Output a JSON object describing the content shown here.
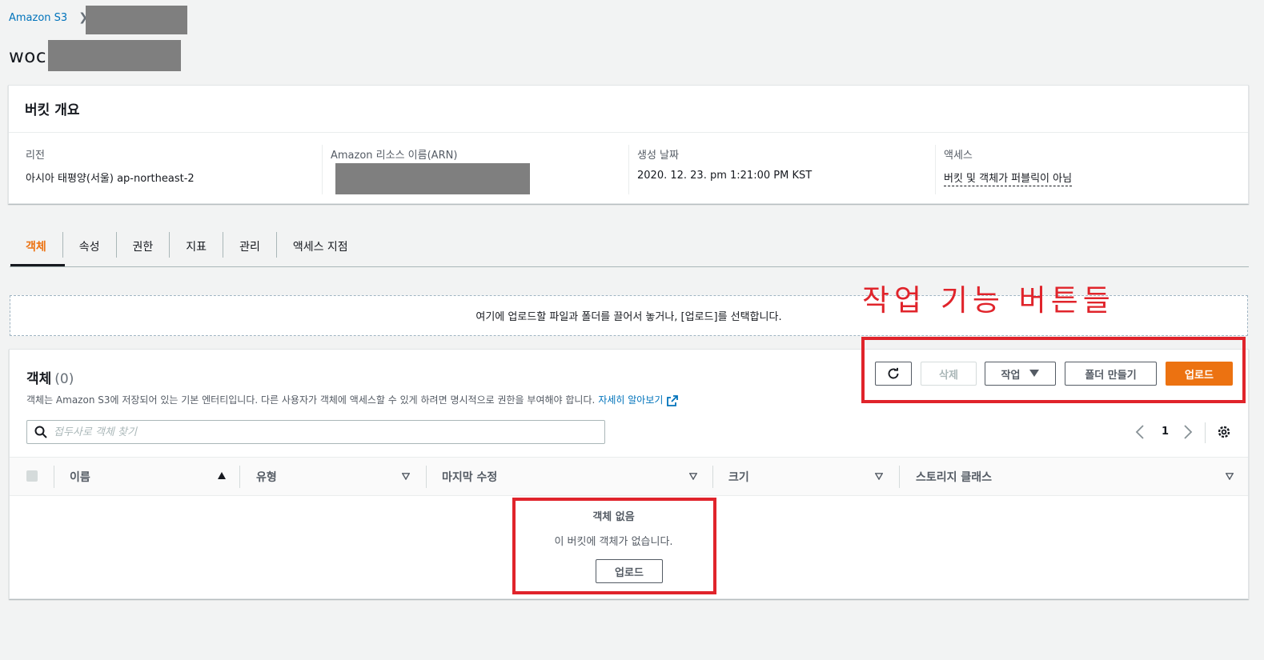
{
  "breadcrumb": {
    "root": "Amazon S3"
  },
  "page": {
    "title_visible": "woc"
  },
  "overview": {
    "title": "버킷 개요",
    "region": {
      "label": "리전",
      "value": "아시아 태평양(서울) ap-northeast-2"
    },
    "arn": {
      "label": "Amazon 리소스 이름(ARN)"
    },
    "created": {
      "label": "생성 날짜",
      "value": "2020. 12. 23. pm 1:21:00 PM KST"
    },
    "access": {
      "label": "액세스",
      "value": "버킷 및 객체가 퍼블릭이 아님"
    }
  },
  "tabs": [
    "객체",
    "속성",
    "권한",
    "지표",
    "관리",
    "액세스 지점"
  ],
  "dropzone": {
    "text": "여기에 업로드할 파일과 폴더를 끌어서 놓거나, [업로드]를 선택합니다."
  },
  "annotation": {
    "text": "작업 기능 버튼들"
  },
  "objects": {
    "title": "객체",
    "count": "(0)",
    "description": "객체는 Amazon S3에 저장되어 있는 기본 엔터티입니다. 다른 사용자가 객체에 액세스할 수 있게 하려면 명시적으로 권한을 부여해야 합니다.",
    "learn_more": "자세히 알아보기",
    "buttons": {
      "delete": "삭제",
      "actions": "작업",
      "create_folder": "폴더 만들기",
      "upload": "업로드"
    },
    "search_placeholder": "접두사로 객체 찾기",
    "page_number": "1",
    "columns": [
      "이름",
      "유형",
      "마지막 수정",
      "크기",
      "스토리지 클래스"
    ],
    "empty": {
      "title": "객체 없음",
      "description": "이 버킷에 객체가 없습니다.",
      "button": "업로드"
    }
  },
  "colors": {
    "accent": "#ec7211",
    "link": "#0073bb",
    "annotation": "#e0242b"
  }
}
